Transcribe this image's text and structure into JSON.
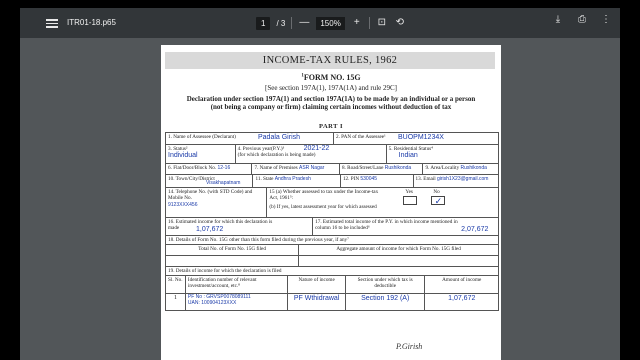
{
  "toolbar": {
    "title": "ITR01-18.p65",
    "page_current": "1",
    "page_total": "/ 3",
    "zoom": "150%",
    "zoom_out": "—",
    "zoom_in": "+"
  },
  "doc": {
    "header": "INCOME-TAX RULES, 1962",
    "form_no_prefix": "1",
    "form_no": "FORM NO. 15G",
    "see_section": "[See section 197A(1), 197A(1A) and rule 29C]",
    "declaration": "Declaration under section 197A(1) and section 197A(1A) to be made by an individual or a person (not being a company or firm) claiming certain incomes without deduction of tax",
    "part": "PART I",
    "f1_label": "1. Name of Assessee (Declarant)",
    "f1_value": "Padala Girish",
    "f2_label": "2. PAN of the Assessee¹",
    "f2_value": "BUOPM1234X",
    "f3_label": "3. Status²",
    "f3_value": "Individual",
    "f4_label": "4. Previous year(P.Y.)³",
    "f4_sub": "(for which declaration is being made)",
    "f4_value": "2021-22",
    "f5_label": "5. Residential Status⁴",
    "f5_value": "Indian",
    "f6_label": "6. Flat/Door/Block No.",
    "f6_value": "12-16",
    "f7_label": "7. Name of Premises",
    "f7_value": "ASR Nagar",
    "f8_label": "8. Road/Street/Lane",
    "f8_value": "Rushikonda",
    "f9_label": "9. Area/Locality",
    "f9_value": "Rushikonda",
    "f10_label": "10. Town/City/District",
    "f10_value": "Visakhapatnam",
    "f11_label": "11. State",
    "f11_value": "Andhra Pradesh",
    "f12_label": "12. PIN",
    "f12_value": "530045",
    "f13_label": "13. Email",
    "f13_value": "girish1X23@gmail.com",
    "f14_label": "14. Telephone No. (with STD Code) and Mobile No.",
    "f14_value": "9123XXX456",
    "f15a_label": "15 (a) Whether assessed to tax under the Income-tax Act, 1961⁵:",
    "f15_yes": "Yes",
    "f15_no": "No",
    "f15_check": "✓",
    "f15b_label": "(b) If yes, latest assessment year for which assessed",
    "f16_label": "16. Estimated income for which this declaration is made",
    "f16_value": "1,07,672",
    "f17_label": "17. Estimated total income of the P.Y. in which income mentioned in column 16 to be included⁶",
    "f17_value": "2,07,672",
    "f18_label": "18. Details of Form No. 15G other than this form filed during the previous year, if any⁷",
    "f18_col1": "Total No. of Form No. 15G filed",
    "f18_col2": "Aggregate amount of income for which Form No. 15G filed",
    "f19_label": "19. Details of income for which the declaration is filed",
    "f19_h_sl": "Sl. No.",
    "f19_h_id": "Identification number of relevant investment/account, etc.⁸",
    "f19_h_nature": "Nature of income",
    "f19_h_section": "Section under which tax is deductible",
    "f19_h_amount": "Amount of income",
    "row1_sl": "1",
    "row1_id1": "PF No : GRVSP0078089111",
    "row1_id2": "UAN: 100904123XXX",
    "row1_nature": "PF Wthidrawal",
    "row1_section": "Section 192 (A)",
    "row1_amount": "1,07,672",
    "signature": "P.Girish"
  }
}
